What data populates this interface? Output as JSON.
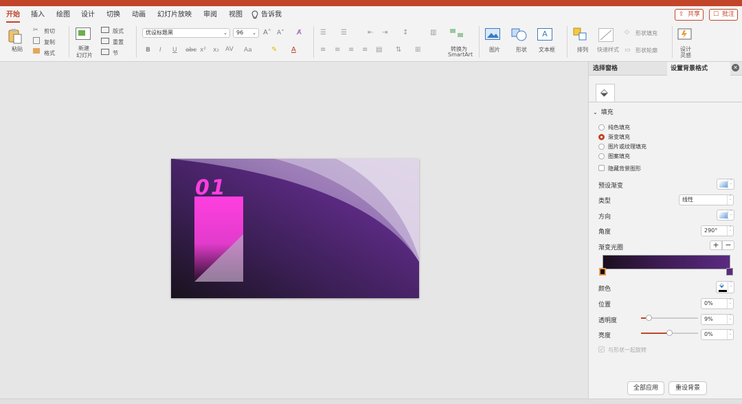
{
  "tabs": [
    "开始",
    "插入",
    "绘图",
    "设计",
    "切换",
    "动画",
    "幻灯片放映",
    "审阅",
    "视图",
    "告诉我"
  ],
  "share": {
    "share_label": "共享",
    "comment_label": "批注"
  },
  "ribbon": {
    "paste": "粘贴",
    "cut": "剪切",
    "copy": "复制",
    "format": "格式",
    "new_slide": "新建\n幻灯片",
    "new_slide_a": "新建",
    "new_slide_b": "幻灯片",
    "layout": "版式",
    "reset": "重置",
    "section": "节",
    "font_name": "优设标题黑",
    "font_size": "96",
    "smartart_a": "转换为",
    "smartart_b": "SmartArt",
    "picture": "图片",
    "shape": "形状",
    "textbox": "文本框",
    "arrange": "排列",
    "quick_style": "快速样式",
    "shape_fill": "形状填充",
    "shape_outline": "形状轮廓",
    "design_a": "设计",
    "design_b": "灵感"
  },
  "pane": {
    "tab1": "选择窗格",
    "tab2": "设置背景格式",
    "section": "填充",
    "options": [
      "纯色填充",
      "渐变填充",
      "图片或纹理填充",
      "图案填充"
    ],
    "selected_option": 1,
    "hide_bg": "隐藏背景图形",
    "preset": "预设渐变",
    "type_label": "类型",
    "type_value": "线性",
    "direction": "方向",
    "angle_label": "角度",
    "angle_value": "290°",
    "stops_label": "渐变光圈",
    "color_label": "颜色",
    "position_label": "位置",
    "position_value": "0%",
    "transparency_label": "透明度",
    "transparency_value": "9%",
    "brightness_label": "亮度",
    "brightness_value": "0%",
    "rotate": "与形状一起旋转",
    "apply_all": "全部应用",
    "reset_bg": "重设背景"
  },
  "slide": {
    "big_text": "01"
  },
  "colors": {
    "accent": "#c2452a",
    "slide_dark": "#1c1320",
    "slide_purple": "#5b2a82",
    "magenta": "#ff3ee0"
  }
}
